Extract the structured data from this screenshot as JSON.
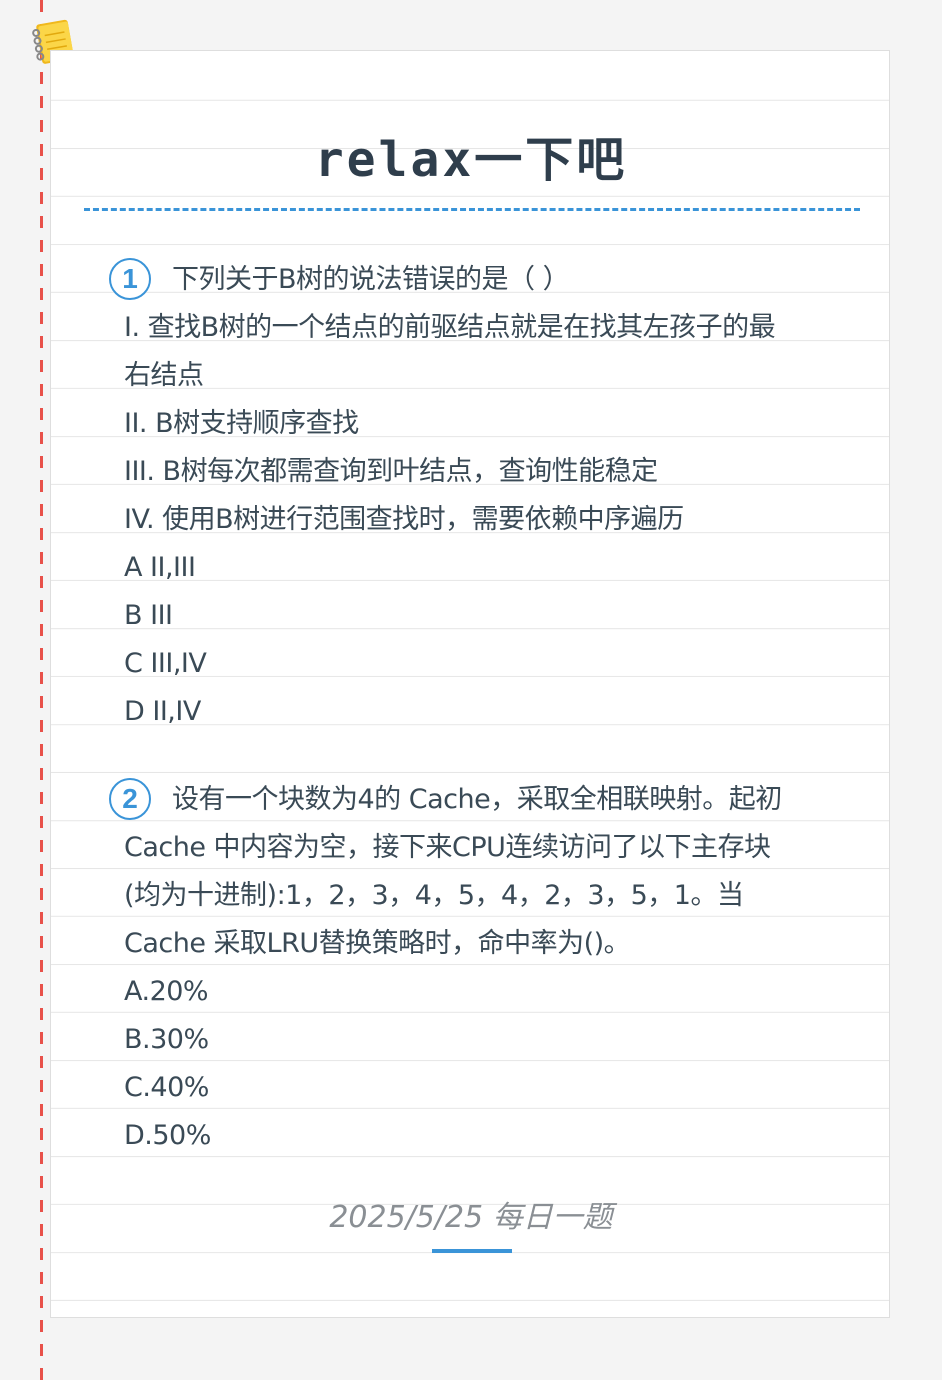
{
  "title": "relax一下吧",
  "questions": [
    {
      "number": "1",
      "lines": [
        "下列关于B树的说法错误的是（   ）",
        "I. 查找B树的一个结点的前驱结点就是在找其左孩子的最",
        "右结点",
        "II. B树支持顺序查找",
        "III. B树每次都需查询到叶结点，查询性能稳定",
        "IV. 使用B树进行范围查找时，需要依赖中序遍历",
        "A II,III",
        "B III",
        "C III,IV",
        "D II,IV"
      ]
    },
    {
      "number": "2",
      "lines": [
        "设有一个块数为4的 Cache，采取全相联映射。起初",
        "Cache 中内容为空，接下来CPU连续访问了以下主存块",
        "(均为十进制):1，2，3，4，5，4，2，3，5，1。当",
        "Cache 采取LRU替换策略时，命中率为()。",
        "A.20%",
        "B.30%",
        "C.40%",
        "D.50%"
      ]
    }
  ],
  "footer": "2025/5/25 每日一题",
  "colors": {
    "accent": "#3a94d8",
    "margin_line": "#e8514a",
    "text": "#3a4a56",
    "title": "#2f3e4c",
    "footer_text": "#8a8f94"
  },
  "icons": {
    "corner": "notebook-icon"
  }
}
